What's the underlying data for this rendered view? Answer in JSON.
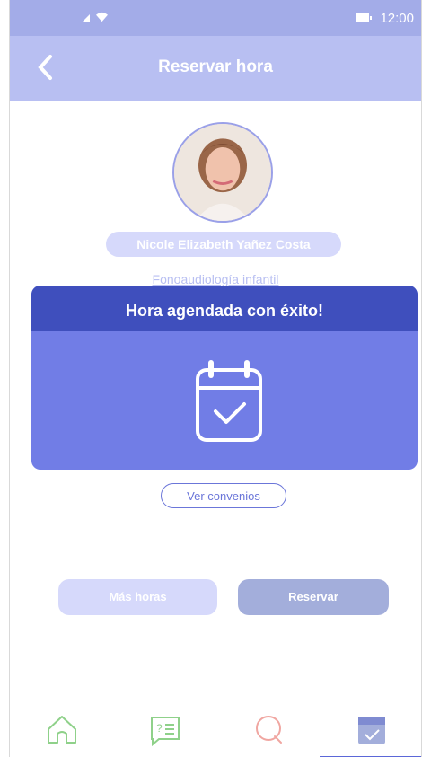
{
  "status_bar": {
    "time": "12:00"
  },
  "header": {
    "title": "Reservar hora"
  },
  "profile": {
    "name": "Nicole Elizabeth Yañez Costa",
    "specialty": "Fonoaudiología infantil"
  },
  "modal": {
    "title": "Hora agendada con éxito!",
    "icon": "calendar-check-icon"
  },
  "buttons": {
    "convenios": "Ver convenios",
    "more_hours": "Más horas",
    "reserve": "Reservar"
  },
  "bottom_nav": [
    {
      "icon": "home-icon"
    },
    {
      "icon": "questions-icon"
    },
    {
      "icon": "search-icon"
    },
    {
      "icon": "calendar-check-icon",
      "active": true
    }
  ],
  "colors": {
    "primary": "#717de6",
    "modal_header": "#3f4fbd",
    "header": "#b8bff2",
    "nav_icons": "#8fd18a"
  }
}
